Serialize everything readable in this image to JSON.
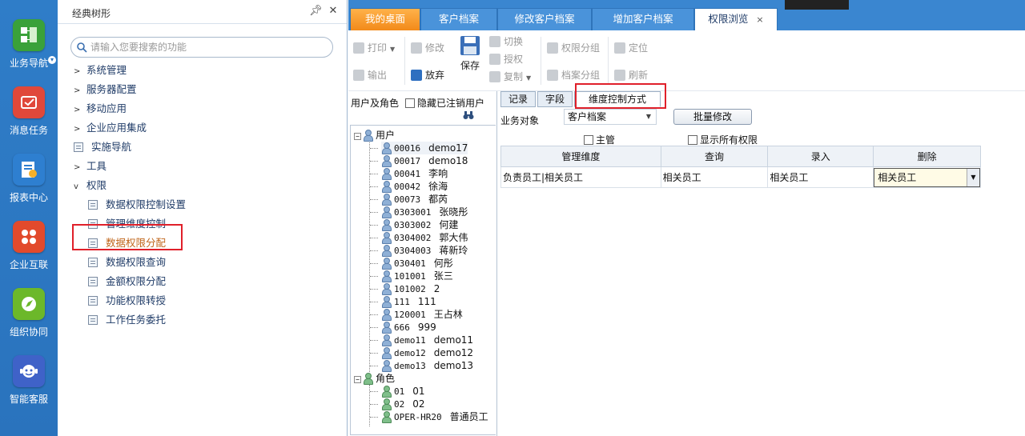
{
  "leftnav": {
    "items": [
      {
        "label": "业务导航",
        "icon": "business-navigation-icon",
        "color": "#3aa13a"
      },
      {
        "label": "消息任务",
        "icon": "message-task-icon",
        "color": "#e0483a"
      },
      {
        "label": "报表中心",
        "icon": "report-center-icon",
        "color": "#2e7fd0"
      },
      {
        "label": "企业互联",
        "icon": "enterprise-connect-icon",
        "color": "#e24a2c"
      },
      {
        "label": "组织协同",
        "icon": "org-collaboration-icon",
        "color": "#6cb82a"
      },
      {
        "label": "智能客服",
        "icon": "smart-service-icon",
        "color": "#3f62c8"
      }
    ]
  },
  "treepanel": {
    "title": "经典树形",
    "pin_icon": "pin-icon",
    "close_icon": "close-icon",
    "search_placeholder": "请输入您要搜索的功能",
    "items": [
      {
        "label": "系统管理",
        "type": "folder"
      },
      {
        "label": "服务器配置",
        "type": "folder"
      },
      {
        "label": "移动应用",
        "type": "folder"
      },
      {
        "label": "企业应用集成",
        "type": "folder"
      },
      {
        "label": "实施导航",
        "type": "doc"
      },
      {
        "label": "工具",
        "type": "folder"
      },
      {
        "label": "权限",
        "type": "folder-open"
      }
    ],
    "subitems": [
      {
        "label": "数据权限控制设置"
      },
      {
        "label": "管理维度控制"
      },
      {
        "label": "数据权限分配",
        "selected": true
      },
      {
        "label": "数据权限查询"
      },
      {
        "label": "金额权限分配"
      },
      {
        "label": "功能权限转授"
      },
      {
        "label": "工作任务委托"
      }
    ]
  },
  "tabs": [
    {
      "label": "我的桌面"
    },
    {
      "label": "客户档案"
    },
    {
      "label": "修改客户档案"
    },
    {
      "label": "增加客户档案"
    },
    {
      "label": "权限浏览",
      "active": true,
      "close": "×"
    }
  ],
  "toolbar": {
    "print": "打印",
    "export": "输出",
    "modify": "修改",
    "discard": "放弃",
    "save": "保存",
    "switch": "切换",
    "authorize": "授权",
    "copy": "复制",
    "perm_group": "权限分组",
    "archive_group": "档案分组",
    "locate": "定位",
    "refresh": "刷新"
  },
  "subpane": {
    "label": "用户及角色",
    "hide_cancelled": "隐藏已注销用户",
    "users_root": "用户",
    "roles_root": "角色",
    "users": [
      {
        "code": "00016",
        "name": "demo17"
      },
      {
        "code": "00017",
        "name": "demo18"
      },
      {
        "code": "00041",
        "name": "李响"
      },
      {
        "code": "00042",
        "name": "徐海"
      },
      {
        "code": "00073",
        "name": "都芮"
      },
      {
        "code": "0303001",
        "name": "张晓彤"
      },
      {
        "code": "0303002",
        "name": "何建"
      },
      {
        "code": "0304002",
        "name": "郭大伟"
      },
      {
        "code": "0304003",
        "name": "蒋新玲"
      },
      {
        "code": "030401",
        "name": "何彤"
      },
      {
        "code": "101001",
        "name": "张三"
      },
      {
        "code": "101002",
        "name": "2"
      },
      {
        "code": "111",
        "name": "111"
      },
      {
        "code": "120001",
        "name": "王占林"
      },
      {
        "code": "666",
        "name": "999"
      },
      {
        "code": "demo11",
        "name": "demo11"
      },
      {
        "code": "demo12",
        "name": "demo12"
      },
      {
        "code": "demo13",
        "name": "demo13"
      }
    ],
    "roles": [
      {
        "code": "01",
        "name": "01"
      },
      {
        "code": "02",
        "name": "02"
      },
      {
        "code": "OPER-HR20",
        "name": "普通员工"
      }
    ]
  },
  "detail": {
    "tabs": [
      "记录",
      "字段",
      "维度控制方式"
    ],
    "biz_label": "业务对象",
    "biz_value": "客户档案",
    "batch_button": "批量修改",
    "chk_master": "主管",
    "chk_show_all": "显示所有权限",
    "grid_headers": [
      "管理维度",
      "查询",
      "录入",
      "删除"
    ],
    "grid_rows": [
      [
        "负责员工|相关员工",
        "相关员工",
        "相关员工",
        "相关员工"
      ]
    ]
  }
}
